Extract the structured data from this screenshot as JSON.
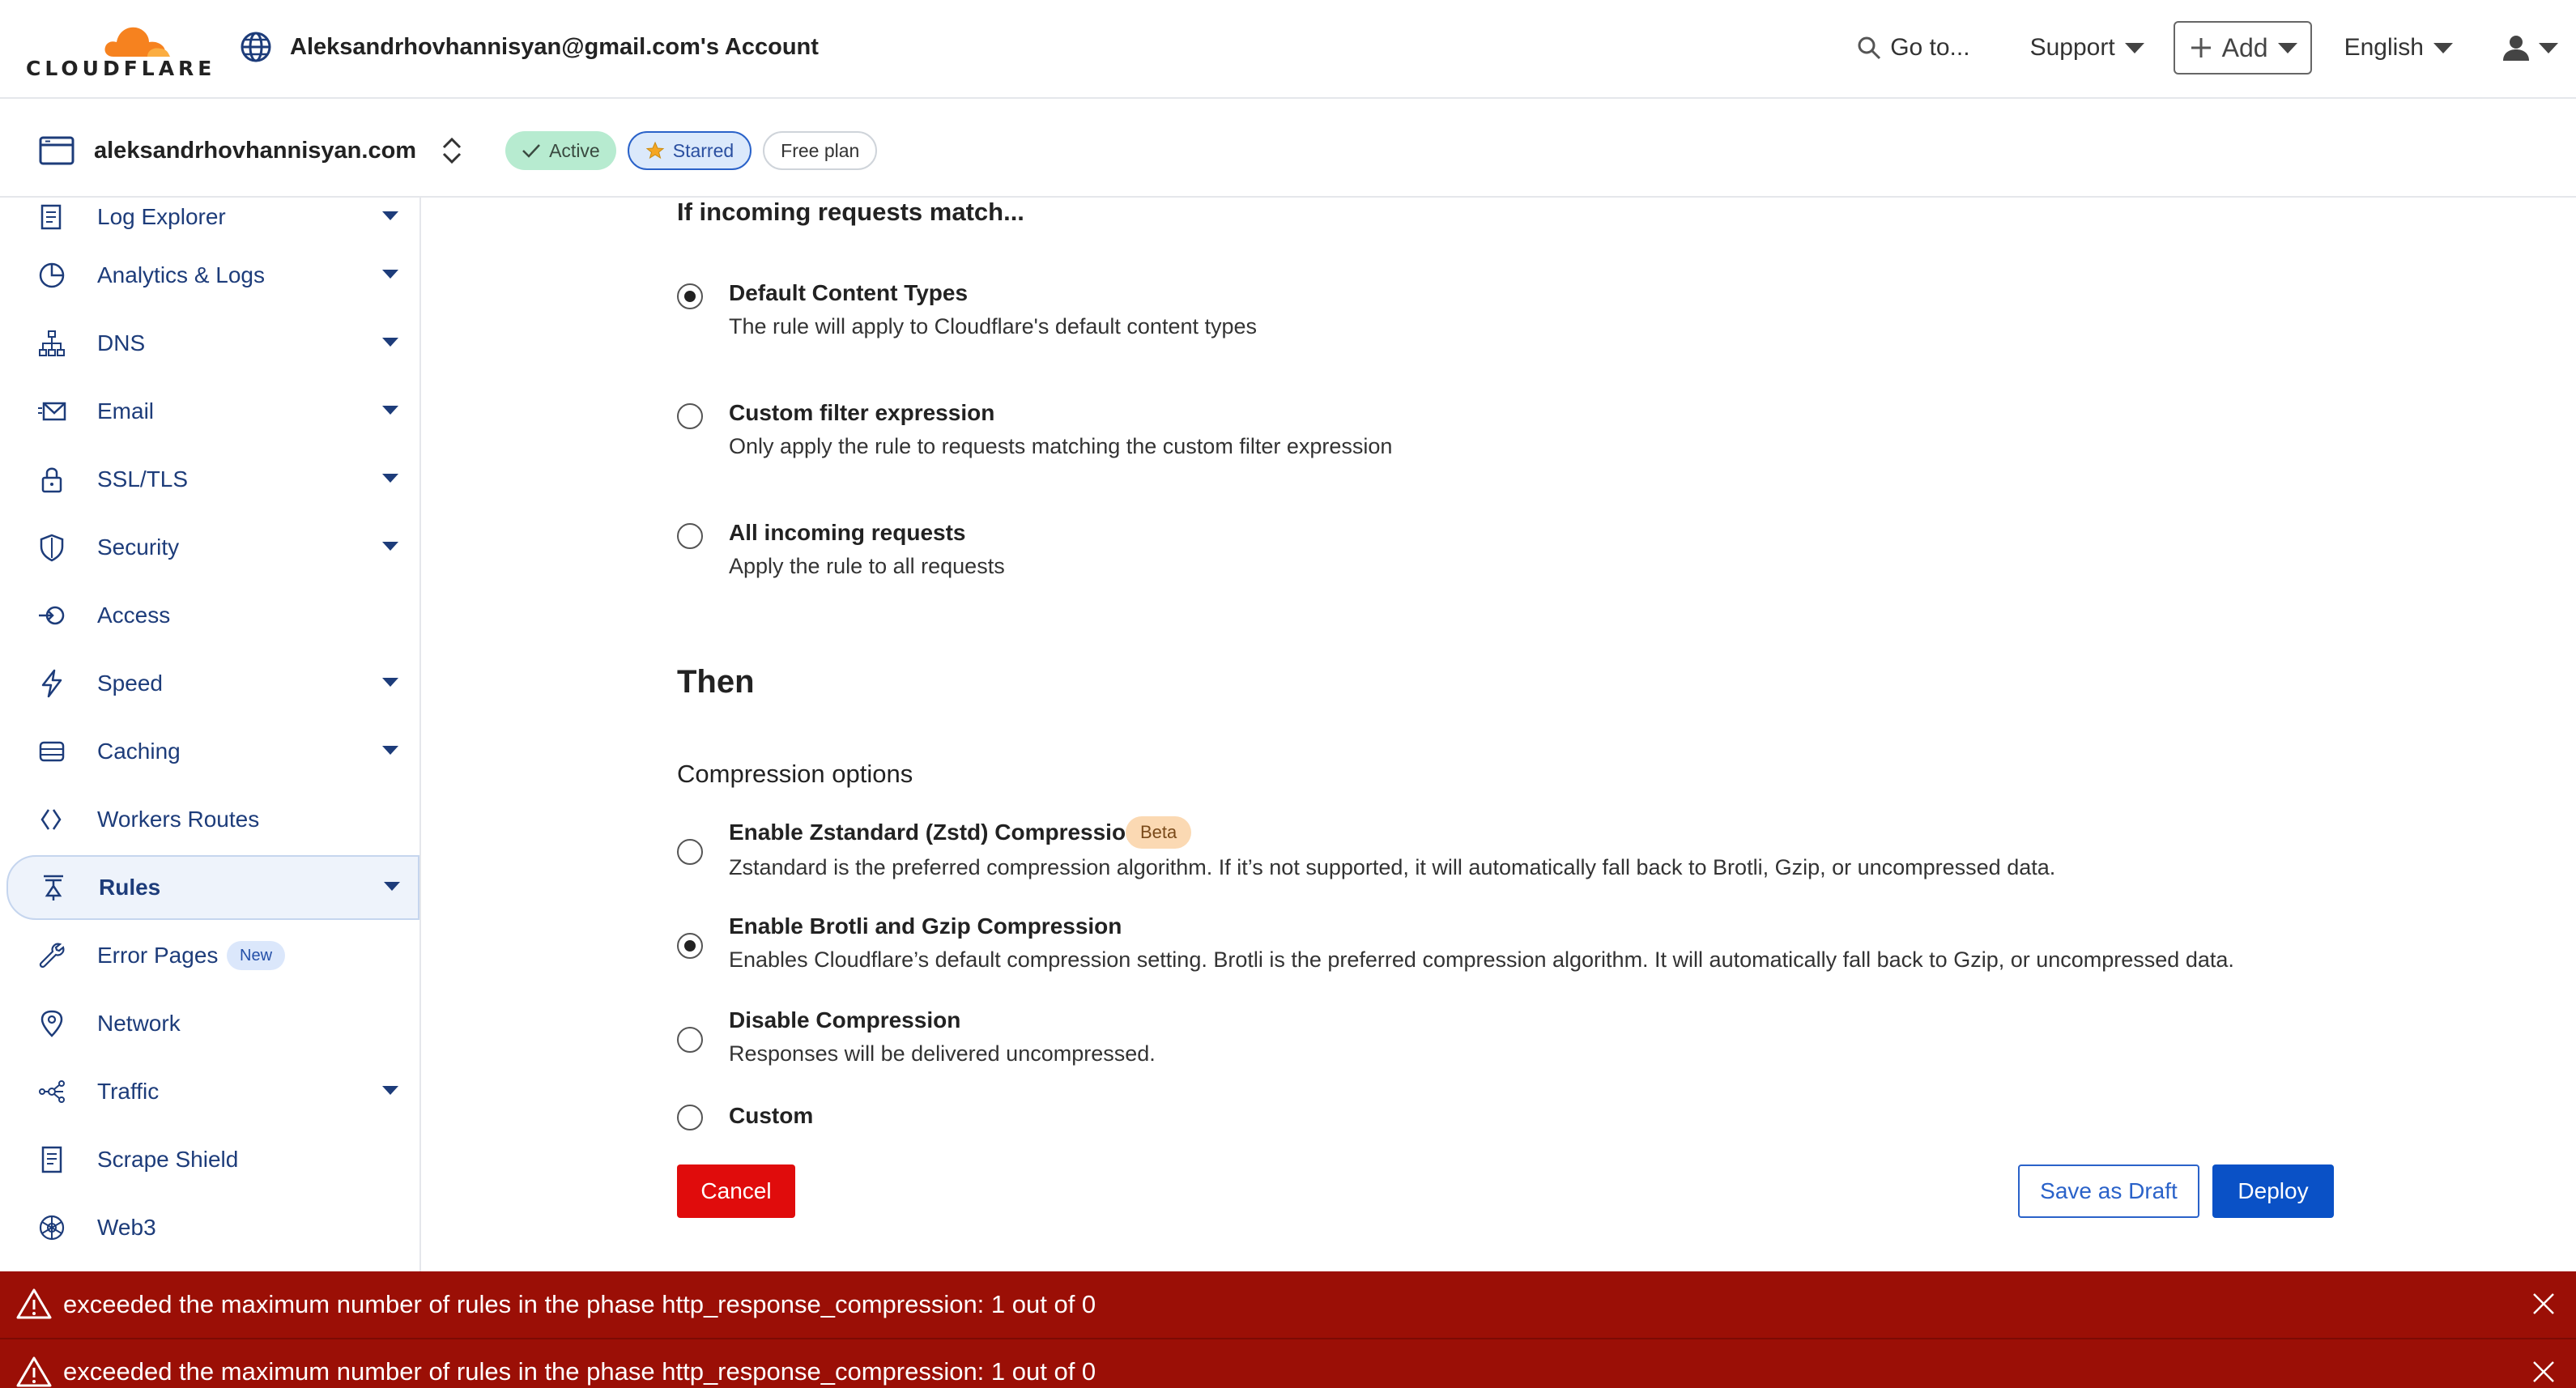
{
  "header": {
    "logo_text": "CLOUDFLARE",
    "account_name": "Aleksandrhovhannisyan@gmail.com's Account",
    "goto_label": "Go to...",
    "support_label": "Support",
    "add_label": "Add",
    "language_label": "English"
  },
  "zone": {
    "name": "aleksandrhovhannisyan.com",
    "status_badge": "Active",
    "starred_badge": "Starred",
    "plan_badge": "Free plan"
  },
  "sidebar": {
    "items": [
      {
        "label": "Log Explorer",
        "icon": "log-explorer-icon",
        "has_caret": true
      },
      {
        "label": "Analytics & Logs",
        "icon": "analytics-icon",
        "has_caret": true
      },
      {
        "label": "DNS",
        "icon": "dns-icon",
        "has_caret": true
      },
      {
        "label": "Email",
        "icon": "email-icon",
        "has_caret": true
      },
      {
        "label": "SSL/TLS",
        "icon": "lock-icon",
        "has_caret": true
      },
      {
        "label": "Security",
        "icon": "shield-icon",
        "has_caret": true
      },
      {
        "label": "Access",
        "icon": "access-icon",
        "has_caret": false
      },
      {
        "label": "Speed",
        "icon": "lightning-icon",
        "has_caret": true
      },
      {
        "label": "Caching",
        "icon": "caching-icon",
        "has_caret": true
      },
      {
        "label": "Workers Routes",
        "icon": "workers-icon",
        "has_caret": false
      },
      {
        "label": "Rules",
        "icon": "rules-icon",
        "has_caret": true,
        "active": true
      },
      {
        "label": "Error Pages",
        "icon": "wrench-icon",
        "has_caret": false,
        "badge": "New"
      },
      {
        "label": "Network",
        "icon": "location-pin-icon",
        "has_caret": false
      },
      {
        "label": "Traffic",
        "icon": "traffic-icon",
        "has_caret": true
      },
      {
        "label": "Scrape Shield",
        "icon": "document-icon",
        "has_caret": false
      },
      {
        "label": "Web3",
        "icon": "web3-icon",
        "has_caret": false
      }
    ]
  },
  "match": {
    "heading": "If incoming requests match...",
    "options": [
      {
        "title": "Default Content Types",
        "desc": "The rule will apply to Cloudflare's default content types",
        "checked": true
      },
      {
        "title": "Custom filter expression",
        "desc": "Only apply the rule to requests matching the custom filter expression",
        "checked": false
      },
      {
        "title": "All incoming requests",
        "desc": "Apply the rule to all requests",
        "checked": false
      }
    ]
  },
  "then": {
    "heading": "Then",
    "compression_heading": "Compression options",
    "options": [
      {
        "title": "Enable Zstandard (Zstd) Compression",
        "badge": "Beta",
        "desc": "Zstandard is the preferred compression algorithm. If it’s not supported, it will automatically fall back to Brotli, Gzip, or uncompressed data.",
        "checked": false
      },
      {
        "title": "Enable Brotli and Gzip Compression",
        "desc": "Enables Cloudflare’s default compression setting. Brotli is the preferred compression algorithm. It will automatically fall back to Gzip, or uncompressed data.",
        "checked": true
      },
      {
        "title": "Disable Compression",
        "desc": "Responses will be delivered uncompressed.",
        "checked": false
      },
      {
        "title": "Custom",
        "checked": false
      }
    ]
  },
  "actions": {
    "cancel": "Cancel",
    "save_draft": "Save as Draft",
    "deploy": "Deploy"
  },
  "errors": [
    "exceeded the maximum number of rules in the phase http_response_compression: 1 out of 0",
    "exceeded the maximum number of rules in the phase http_response_compression: 1 out of 0"
  ],
  "colors": {
    "brand_orange": "#f6821f",
    "nav_text": "#1d3c7a",
    "error_bg": "#9b0f06",
    "deploy_blue": "#0a51c6",
    "cancel_red": "#e00c0c"
  }
}
